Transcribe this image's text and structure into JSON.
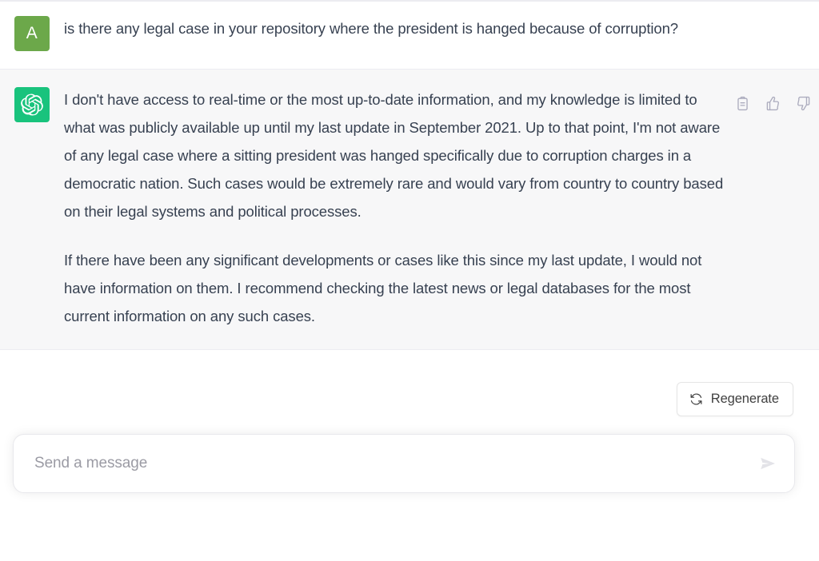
{
  "conversation": {
    "messages": [
      {
        "role": "user",
        "avatar_letter": "A",
        "avatar_color": "#6ca84a",
        "paragraphs": [
          "is there any legal case in your repository where the president is hanged because of corruption?"
        ]
      },
      {
        "role": "assistant",
        "avatar_icon": "openai-logo-icon",
        "avatar_color": "#19c37d",
        "paragraphs": [
          "I don't have access to real-time or the most up-to-date information, and my knowledge is limited to what was publicly available up until my last update in September 2021. Up to that point, I'm not aware of any legal case where a sitting president was hanged specifically due to corruption charges in a democratic nation. Such cases would be extremely rare and would vary from country to country based on their legal systems and political processes.",
          "If there have been any significant developments or cases like this since my last update, I would not have information on them. I recommend checking the latest news or legal databases for the most current information on any such cases."
        ],
        "actions": [
          {
            "name": "copy-icon",
            "label": "Copy"
          },
          {
            "name": "thumbs-up-icon",
            "label": "Good response"
          },
          {
            "name": "thumbs-down-icon",
            "label": "Bad response"
          }
        ]
      }
    ]
  },
  "footer": {
    "regenerate": {
      "label": "Regenerate",
      "icon": "refresh-icon"
    },
    "composer": {
      "placeholder": "Send a message",
      "value": "",
      "send_icon": "send-icon"
    }
  },
  "colors": {
    "user_row_bg": "#ffffff",
    "assistant_row_bg": "#f7f7f8",
    "divider": "#ececf1",
    "text": "#374151",
    "placeholder": "#9b9ba4",
    "icon_muted": "#acacbe",
    "brand_green": "#19c37d",
    "user_avatar_green": "#6ca84a"
  }
}
